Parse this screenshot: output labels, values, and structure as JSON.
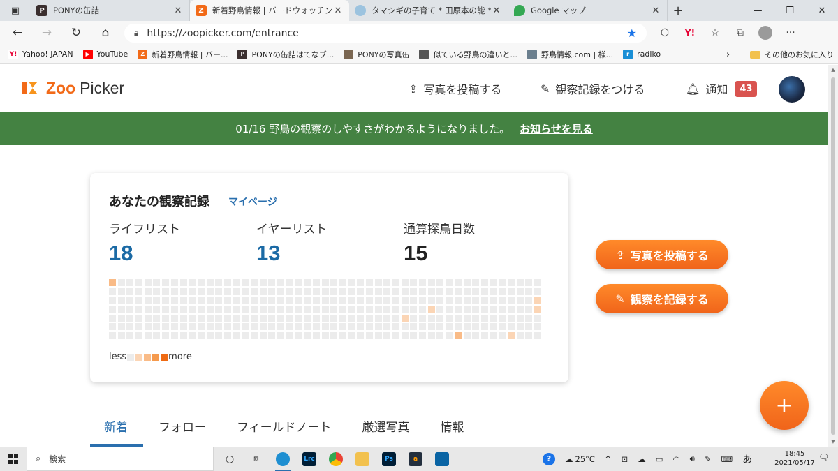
{
  "browser": {
    "tabs": [
      {
        "title": "PONYの缶詰",
        "active": false
      },
      {
        "title": "新着野鳥情報 | バードウォッチングな",
        "active": true
      },
      {
        "title": "タマシギの子育て * 田原本の能 *",
        "active": false
      },
      {
        "title": "Google マップ",
        "active": false
      }
    ],
    "url": "https://zoopicker.com/entrance",
    "bookmarks": [
      {
        "label": "Yahoo! JAPAN"
      },
      {
        "label": "YouTube"
      },
      {
        "label": "新着野鳥情報 | バー..."
      },
      {
        "label": "PONYの缶詰はてなブ..."
      },
      {
        "label": "PONYの写真缶"
      },
      {
        "label": "似ている野鳥の違いと..."
      },
      {
        "label": "野鳥情報.com | 様..."
      },
      {
        "label": "radiko"
      }
    ],
    "other_favorites": "その他のお気に入り"
  },
  "site": {
    "logo_zoo": "Zoo",
    "logo_picker": "Picker",
    "nav": {
      "post_photo": "写真を投稿する",
      "record": "観察記録をつける",
      "notify": "通知",
      "notify_count": "43"
    }
  },
  "banner": {
    "text": "01/16 野鳥の観察のしやすさがわかるようになりました。",
    "link": "お知らせを見る"
  },
  "card": {
    "title": "あなたの観察記録",
    "mypage_link": "マイページ",
    "stats": [
      {
        "label": "ライフリスト",
        "value": "18",
        "color": "#1b6aa5"
      },
      {
        "label": "イヤーリスト",
        "value": "13",
        "color": "#1b6aa5"
      },
      {
        "label": "通算探鳥日数",
        "value": "15",
        "color": "#222222"
      }
    ],
    "legend_less": "less",
    "legend_more": "more"
  },
  "activity": {
    "weeks": 49,
    "days": 7,
    "colors": [
      "#ececec",
      "#fbd5b5",
      "#f9bb87",
      "#f59a4d",
      "#ef6a12"
    ],
    "active_cells": [
      [
        0,
        0,
        2
      ],
      [
        33,
        4,
        1
      ],
      [
        36,
        3,
        1
      ],
      [
        39,
        6,
        2
      ],
      [
        45,
        6,
        1
      ],
      [
        48,
        2,
        1
      ],
      [
        48,
        3,
        1
      ],
      [
        49,
        4,
        2
      ],
      [
        51,
        5,
        1
      ],
      [
        52,
        0,
        1
      ],
      [
        54,
        6,
        2
      ],
      [
        55,
        4,
        1
      ],
      [
        56,
        2,
        1
      ],
      [
        57,
        5,
        1
      ],
      [
        58,
        4,
        2
      ]
    ]
  },
  "cta": {
    "post_photo": "写真を投稿する",
    "record": "観察を記録する"
  },
  "content_tabs": [
    "新着",
    "フォロー",
    "フィールドノート",
    "厳選写真",
    "情報"
  ],
  "taskbar": {
    "search_placeholder": "検索",
    "temperature": "25°C",
    "ime": "あ",
    "time": "18:45",
    "date": "2021/05/17"
  }
}
